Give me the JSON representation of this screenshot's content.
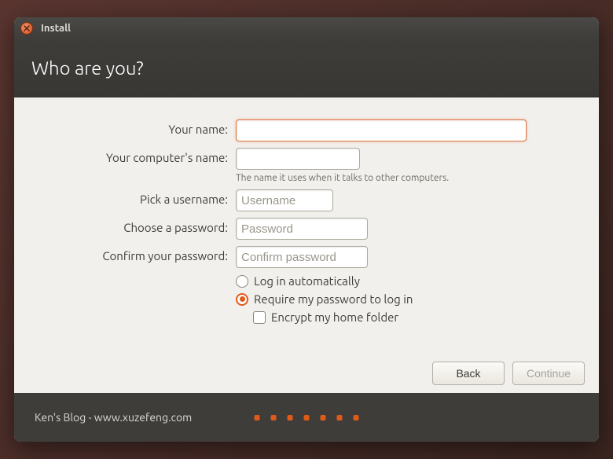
{
  "window": {
    "title": "Install"
  },
  "header": {
    "title": "Who are you?"
  },
  "form": {
    "name_label": "Your name:",
    "name_value": "",
    "computer_label": "Your computer's name:",
    "computer_value": "",
    "computer_hint": "The name it uses when it talks to other computers.",
    "username_label": "Pick a username:",
    "username_placeholder": "Username",
    "username_value": "",
    "password_label": "Choose a password:",
    "password_placeholder": "Password",
    "password_value": "",
    "confirm_label": "Confirm your password:",
    "confirm_placeholder": "Confirm password",
    "confirm_value": "",
    "auto_login_label": "Log in automatically",
    "require_password_label": "Require my password to log in",
    "encrypt_label": "Encrypt my home folder",
    "login_mode": "require_password",
    "encrypt_checked": false
  },
  "buttons": {
    "back": "Back",
    "continue": "Continue"
  },
  "footer": {
    "text": "Ken's Blog - www.xuzefeng.com",
    "dot_count": 7
  },
  "colors": {
    "accent": "#e05a1a",
    "titlebar_bg": "#3e3d3a",
    "content_bg": "#f2f0ec"
  }
}
